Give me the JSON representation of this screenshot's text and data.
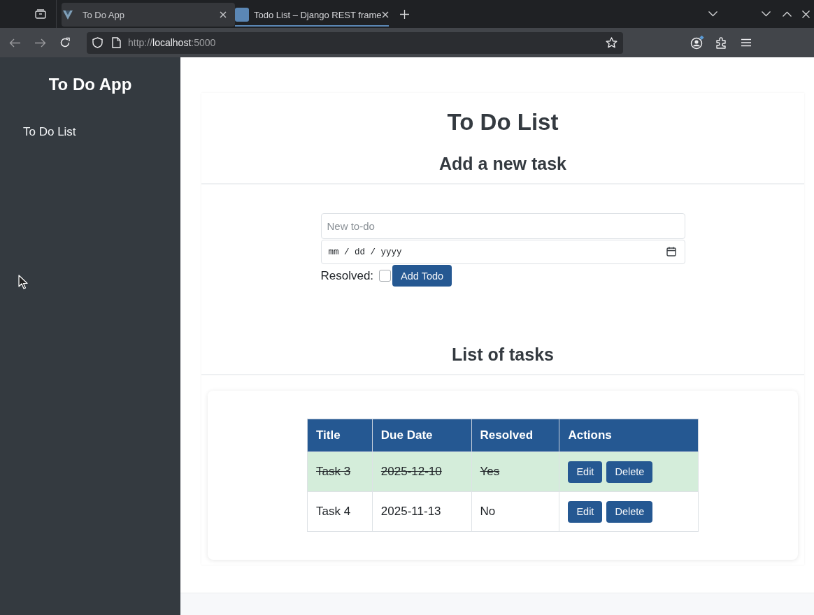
{
  "browser": {
    "tabs": [
      {
        "title": "To Do App",
        "selected": true,
        "grouped": false
      },
      {
        "title": "Todo List – Django REST frame",
        "selected": false,
        "grouped": true
      }
    ],
    "address": {
      "scheme": "http://",
      "host": "localhost",
      "port": ":5000"
    }
  },
  "sidebar": {
    "title": "To Do App",
    "items": [
      {
        "label": "To Do List"
      }
    ]
  },
  "page": {
    "title": "To Do List",
    "add_form": {
      "heading": "Add a new task",
      "title_field": {
        "placeholder": "New to-do"
      },
      "date_field": {
        "placeholder": "mm / dd / yyyy"
      },
      "resolved_checkbox": {
        "label": "Resolved:",
        "checked": false
      },
      "submit_button": "Add Todo"
    },
    "task_list": {
      "heading": "List of tasks",
      "table": {
        "columns": [
          "Title",
          "Due Date",
          "Resolved",
          "Actions"
        ],
        "rows": [
          {
            "title": "Task 3",
            "due_date": "2025-12-10",
            "resolved_label": "Yes",
            "resolved": true,
            "actions": [
              "Edit",
              "Delete"
            ]
          },
          {
            "title": "Task 4",
            "due_date": "2025-11-13",
            "resolved_label": "No",
            "resolved": false,
            "actions": [
              "Edit",
              "Delete"
            ]
          }
        ]
      }
    }
  }
}
